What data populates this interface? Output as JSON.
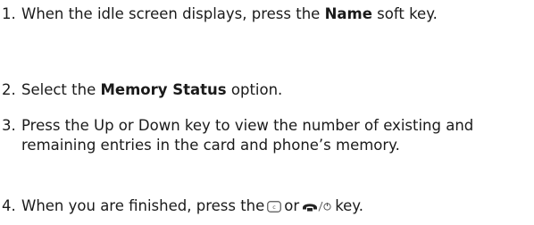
{
  "steps": [
    {
      "number": "1.",
      "before": "When the idle screen displays, press the ",
      "bold": "Name",
      "after": " soft key."
    },
    {
      "number": "2.",
      "before": "Select the ",
      "bold": "Memory Status",
      "after": " option."
    },
    {
      "number": "3.",
      "text": "Press the Up or Down key to view the number of existing and remaining entries in the card and phone’s memory."
    },
    {
      "number": "4.",
      "before": "When you are finished, press the",
      "middle": "or",
      "after": "key.",
      "icons": [
        "clear-key-icon",
        "end-power-key-icon"
      ]
    }
  ]
}
